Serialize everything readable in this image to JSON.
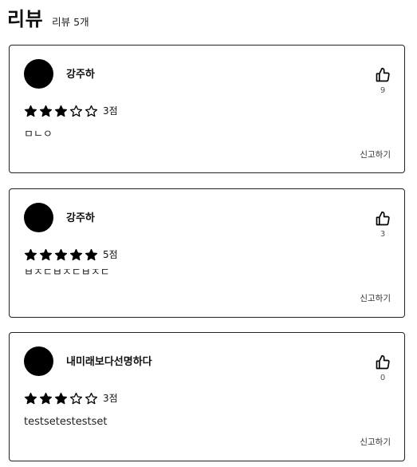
{
  "header": {
    "title": "리뷰",
    "count_label": "리뷰 5개"
  },
  "reviews": [
    {
      "author": "강주하",
      "likes": "9",
      "rating": 3,
      "rating_label": "3점",
      "content": "ㅁㄴㅇ",
      "report_label": "신고하기"
    },
    {
      "author": "강주하",
      "likes": "3",
      "rating": 5,
      "rating_label": "5점",
      "content": "ㅂㅈㄷㅂㅈㄷㅂㅈㄷ",
      "report_label": "신고하기"
    },
    {
      "author": "내미래보다선명하다",
      "likes": "0",
      "rating": 3,
      "rating_label": "3점",
      "content": "testsetestestset",
      "report_label": "신고하기"
    }
  ],
  "icons": {
    "like": "thumbs-up-icon",
    "star_filled": "star-filled-icon",
    "star_empty": "star-outline-icon"
  }
}
